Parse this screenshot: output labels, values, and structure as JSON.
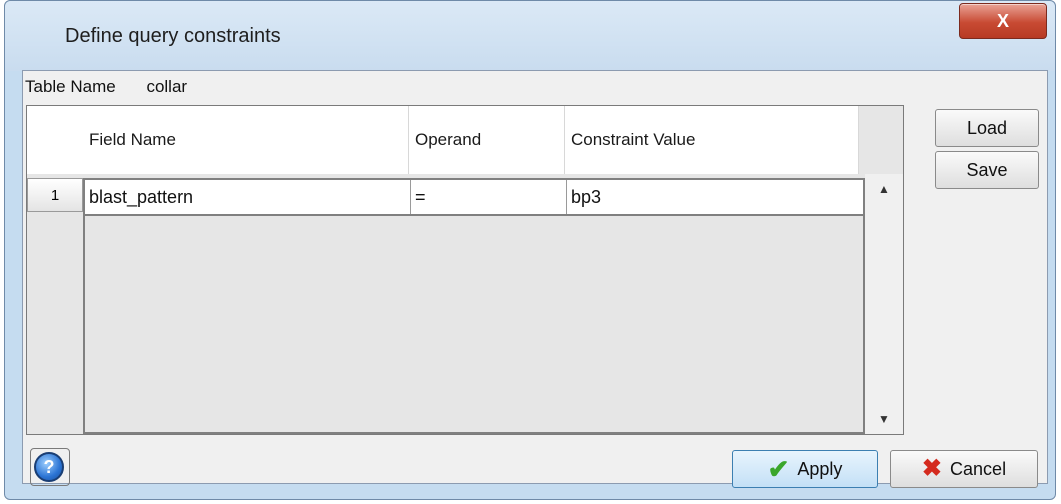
{
  "window": {
    "title": "Define query constraints",
    "close_glyph": "X"
  },
  "table_name": {
    "label": "Table Name",
    "value": "collar"
  },
  "grid": {
    "columns": [
      "Field Name",
      "Operand",
      "Constraint Value"
    ],
    "rows": [
      {
        "number": "1",
        "field": "blast_pattern",
        "operand": "=",
        "value": "bp3"
      }
    ],
    "scroll_up_icon": "▲",
    "scroll_down_icon": "▼"
  },
  "side_buttons": {
    "load": "Load",
    "save": "Save"
  },
  "footer": {
    "help_glyph": "?",
    "apply": "Apply",
    "apply_icon": "✔",
    "cancel": "Cancel",
    "cancel_icon": "✖"
  }
}
